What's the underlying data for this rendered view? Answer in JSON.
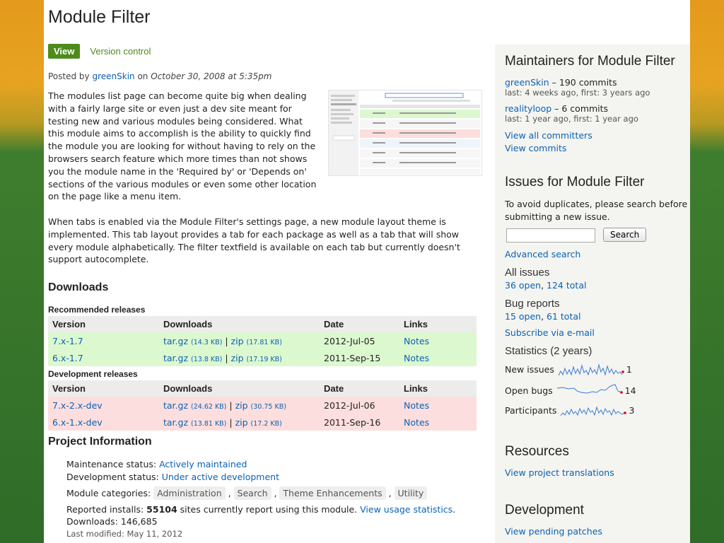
{
  "title": "Module Filter",
  "tabs": {
    "view": "View",
    "version_control": "Version control"
  },
  "post": {
    "prefix": "Posted by",
    "author": "greenSkin",
    "on": "on",
    "date": "October 30, 2008 at 5:35pm"
  },
  "intro": "The modules list page can become quite big when dealing with a fairly large site or even just a dev site meant for testing new and various modules being considered. What this module aims to accomplish is the ability to quickly find the module you are looking for without having to rely on the browsers search feature which more times than not shows you the module name in the 'Required by' or 'Depends on' sections of the various modules or even some other location on the page like a menu item.",
  "para2": "When tabs is enabled via the Module Filter's settings page, a new module layout theme is implemented. This tab layout provides a tab for each package as well as a tab that will show every module alphabetically. The filter textfield is available on each tab but currently doesn't support autocomplete.",
  "downloads": {
    "heading": "Downloads",
    "recommended_label": "Recommended releases",
    "development_label": "Development releases",
    "headers": [
      "Version",
      "Downloads",
      "Date",
      "Links"
    ],
    "recommended": [
      {
        "version": "7.x-1.7",
        "targz": "tar.gz",
        "targz_size": "(14.3 KB)",
        "sep": "|",
        "zip": "zip",
        "zip_size": "(17.81 KB)",
        "date": "2012-Jul-05",
        "link": "Notes"
      },
      {
        "version": "6.x-1.7",
        "targz": "tar.gz",
        "targz_size": "(13.8 KB)",
        "sep": "|",
        "zip": "zip",
        "zip_size": "(17.19 KB)",
        "date": "2011-Sep-15",
        "link": "Notes"
      }
    ],
    "development": [
      {
        "version": "7.x-2.x-dev",
        "targz": "tar.gz",
        "targz_size": "(24.62 KB)",
        "sep": "|",
        "zip": "zip",
        "zip_size": "(30.75 KB)",
        "date": "2012-Jul-06",
        "link": "Notes"
      },
      {
        "version": "6.x-1.x-dev",
        "targz": "tar.gz",
        "targz_size": "(13.81 KB)",
        "sep": "|",
        "zip": "zip",
        "zip_size": "(17.2 KB)",
        "date": "2011-Sep-16",
        "link": "Notes"
      }
    ]
  },
  "project": {
    "heading": "Project Information",
    "maintenance_label": "Maintenance status:",
    "maintenance_value": "Actively maintained",
    "development_label": "Development status:",
    "development_value": "Under active development",
    "categories_label": "Module categories:",
    "categories": [
      "Administration",
      "Search",
      "Theme Enhancements",
      "Utility"
    ],
    "installs_label": "Reported installs:",
    "installs_count": "55104",
    "installs_suffix": "sites currently report using this module.",
    "usage_link": "View usage statistics",
    "downloads_label": "Downloads:",
    "downloads_value": "146,685",
    "last_modified": "Last modified: May 11, 2012"
  },
  "sidebar": {
    "maintainers_heading": "Maintainers for Module Filter",
    "maintainers": [
      {
        "name": "greenSkin",
        "commits": " – 190 commits",
        "meta": "last: 4 weeks ago, first: 3 years ago"
      },
      {
        "name": "realityloop",
        "commits": " – 6 commits",
        "meta": "last: 1 year ago, first: 1 year ago"
      }
    ],
    "view_all_committers": "View all committers",
    "view_commits": "View commits",
    "issues_heading": "Issues for Module Filter",
    "issues_text": "To avoid duplicates, please search before submitting a new issue.",
    "search_button": "Search",
    "advanced_search": "Advanced search",
    "all_issues_label": "All issues",
    "all_open": "36 open",
    "all_total": "124 total",
    "bug_reports_label": "Bug reports",
    "bug_open": "15 open",
    "bug_total": "61 total",
    "subscribe": "Subscribe via e-mail",
    "statistics_label": "Statistics",
    "statistics_period": "(2 years)",
    "stats": [
      {
        "label": "New issues",
        "value": "1"
      },
      {
        "label": "Open bugs",
        "value": "14"
      },
      {
        "label": "Participants",
        "value": "3"
      }
    ],
    "resources_heading": "Resources",
    "view_translations": "View project translations",
    "development_heading": "Development",
    "view_pending_patches": "View pending patches"
  },
  "colors": {
    "link": "#0b62b3",
    "tab_green": "#4e8b1d",
    "recommended_bg": "#dcf8cf",
    "development_bg": "#fddede",
    "sparkline_dot": "#d0021b"
  }
}
